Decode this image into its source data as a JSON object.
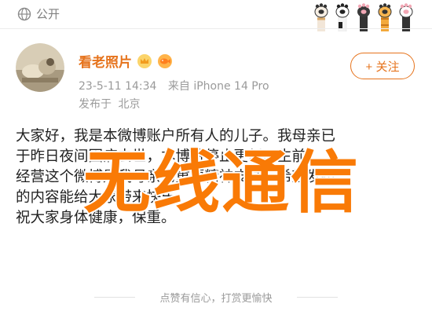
{
  "header": {
    "visibility": "公开"
  },
  "post": {
    "author": "看老照片",
    "time": "23-5-11 14:34",
    "source": "来自 iPhone 14 Pro",
    "location_prefix": "发布于",
    "location": "北京",
    "follow_label": "+ 关注",
    "lines": [
      "大家好，我是本微博账户所有人的儿子。我母亲已",
      "于昨日夜间因病去世，本博将停止更新。生前",
      "经营这个微博是我母亲的重要精神支柱，希望发布",
      "的内容能给大家带来快乐。",
      "祝大家身体健康，保重。"
    ]
  },
  "watermark": {
    "text": "无线通信"
  },
  "footer": {
    "appreciation": "点赞有信心，打赏更愉快"
  },
  "colors": {
    "accent": "#e6731c",
    "watermark": "#f97a06",
    "meta": "#9a9a9a"
  },
  "icons": [
    "globe-icon",
    "avatar",
    "crown-badge-icon",
    "fish-badge-icon",
    "cat-paw-icon"
  ]
}
